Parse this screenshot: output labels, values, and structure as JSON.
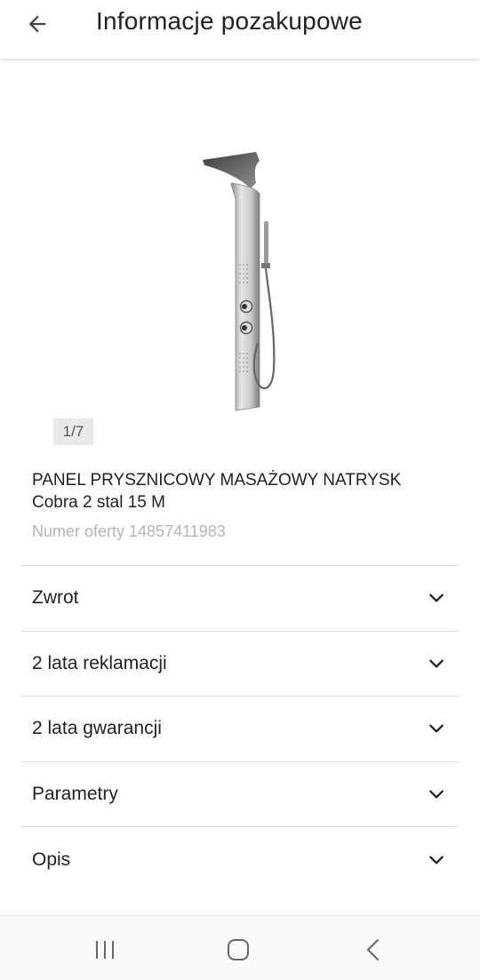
{
  "header": {
    "title": "Informacje pozakupowe",
    "back_icon": "arrow-left-icon"
  },
  "gallery": {
    "counter": "1/7",
    "image_subject": "stainless steel shower panel"
  },
  "product": {
    "title": "PANEL PRYSZNICOWY MASAŻOWY NATRYSK Cobra 2 stal 15 M",
    "offer_number": "Numer oferty 14857411983"
  },
  "sections": [
    {
      "label": "Zwrot",
      "icon": "chevron-down-icon"
    },
    {
      "label": "2 lata reklamacji",
      "icon": "chevron-down-icon"
    },
    {
      "label": "2 lata gwarancji",
      "icon": "chevron-down-icon"
    },
    {
      "label": "Parametry",
      "icon": "chevron-down-icon"
    },
    {
      "label": "Opis",
      "icon": "chevron-down-icon"
    }
  ],
  "navbar": {
    "recents_icon": "recent-apps-icon",
    "home_icon": "home-icon",
    "back_icon": "back-icon"
  },
  "colors": {
    "text": "#222222",
    "muted": "#b5b5b5",
    "divider": "#dcdcdc"
  }
}
